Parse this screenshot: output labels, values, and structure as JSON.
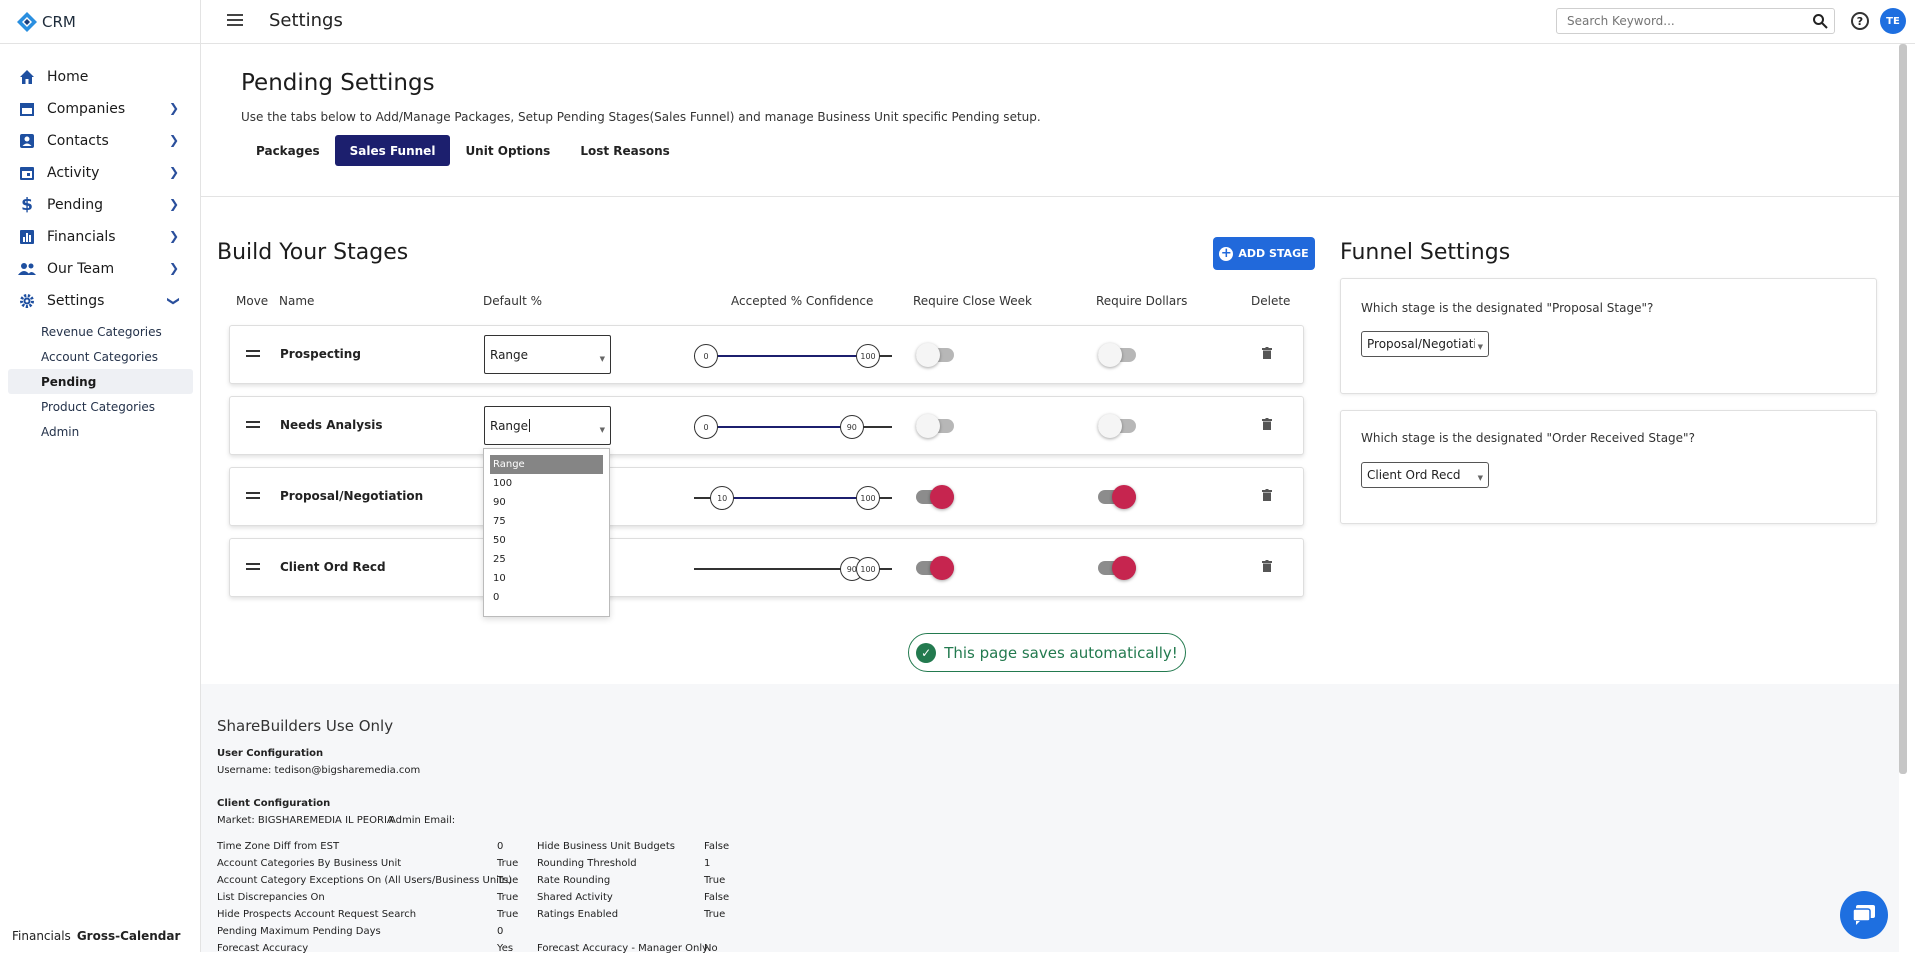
{
  "app": {
    "name": "CRM",
    "title": "Settings"
  },
  "search": {
    "placeholder": "Search Keyword..."
  },
  "user": {
    "initials": "TE"
  },
  "sidebar": {
    "items": [
      {
        "label": "Home",
        "icon": "home-icon"
      },
      {
        "label": "Companies",
        "icon": "store-icon"
      },
      {
        "label": "Contacts",
        "icon": "contact-card-icon"
      },
      {
        "label": "Activity",
        "icon": "calendar-icon"
      },
      {
        "label": "Pending",
        "icon": "dollar-icon"
      },
      {
        "label": "Financials",
        "icon": "bar-chart-icon"
      },
      {
        "label": "Our Team",
        "icon": "people-icon"
      },
      {
        "label": "Settings",
        "icon": "gear-icon"
      }
    ],
    "sub_items": [
      "Revenue Categories",
      "Account Categories",
      "Pending",
      "Product Categories",
      "Admin"
    ],
    "active_sub": "Pending",
    "footer_label": "Financials",
    "footer_value": "Gross-Calendar"
  },
  "header": {
    "title": "Pending Settings",
    "subtitle": "Use the tabs below to Add/Manage Packages, Setup Pending Stages(Sales Funnel) and manage Business Unit specific Pending setup.",
    "tabs": [
      "Packages",
      "Sales Funnel",
      "Unit Options",
      "Lost Reasons"
    ],
    "active_tab": "Sales Funnel"
  },
  "stages": {
    "title": "Build Your Stages",
    "add_label": "ADD STAGE",
    "columns": {
      "move": "Move",
      "name": "Name",
      "default": "Default %",
      "confidence": "Accepted % Confidence",
      "close_week": "Require Close Week",
      "dollars": "Require Dollars",
      "delete": "Delete"
    },
    "rows": [
      {
        "name": "Prospecting",
        "default": "Range",
        "low": 0,
        "high": 100,
        "close_week": false,
        "dollars": false
      },
      {
        "name": "Needs Analysis",
        "default": "Range",
        "low": 0,
        "high": 90,
        "close_week": false,
        "dollars": false
      },
      {
        "name": "Proposal/Negotiation",
        "default": "",
        "low": 10,
        "high": 100,
        "close_week": true,
        "dollars": true
      },
      {
        "name": "Client Ord Recd",
        "default": "",
        "low": 90,
        "high": 100,
        "close_week": true,
        "dollars": true
      }
    ],
    "dropdown_options": [
      "Range",
      "100",
      "90",
      "75",
      "50",
      "25",
      "10",
      "0"
    ],
    "dropdown_highlight": "Range"
  },
  "autosave": {
    "text": "This page saves automatically!"
  },
  "funnel": {
    "title": "Funnel Settings",
    "proposal_question": "Which stage is the designated \"Proposal Stage\"?",
    "proposal_value": "Proposal/Negotiation",
    "order_question": "Which stage is the designated \"Order Received Stage\"?",
    "order_value": "Client Ord Recd"
  },
  "admin": {
    "title": "ShareBuilders Use Only",
    "user_config": "User Configuration",
    "username": "Username: tedison@bigsharemedia.com",
    "client_config": "Client Configuration",
    "market": "Market: BIGSHAREMEDIA IL PEORIA",
    "admin_email": "Admin Email:",
    "left_rows": [
      {
        "label": "Time Zone Diff from EST",
        "value": "0"
      },
      {
        "label": "Account Categories By Business Unit",
        "value": "True"
      },
      {
        "label": "Account Category Exceptions On (All Users/Business Units)",
        "value": "True"
      },
      {
        "label": "List Discrepancies On",
        "value": "True"
      },
      {
        "label": "Hide Prospects Account Request Search",
        "value": "True"
      },
      {
        "label": "Pending Maximum Pending Days",
        "value": "0"
      },
      {
        "label": "Forecast Accuracy",
        "value": "Yes"
      }
    ],
    "right_rows": [
      {
        "label": "Hide Business Unit Budgets",
        "value": "False"
      },
      {
        "label": "Rounding Threshold",
        "value": "1"
      },
      {
        "label": "Rate Rounding",
        "value": "True"
      },
      {
        "label": "Shared Activity",
        "value": "False"
      },
      {
        "label": "Ratings Enabled",
        "value": "True"
      },
      {
        "label": "Forecast Accuracy - Manager Only",
        "value": "No"
      }
    ]
  },
  "colors": {
    "brand": "#1c1f6e",
    "accent": "#2169db",
    "toggle_on": "#c6254f",
    "success": "#237a4f"
  }
}
